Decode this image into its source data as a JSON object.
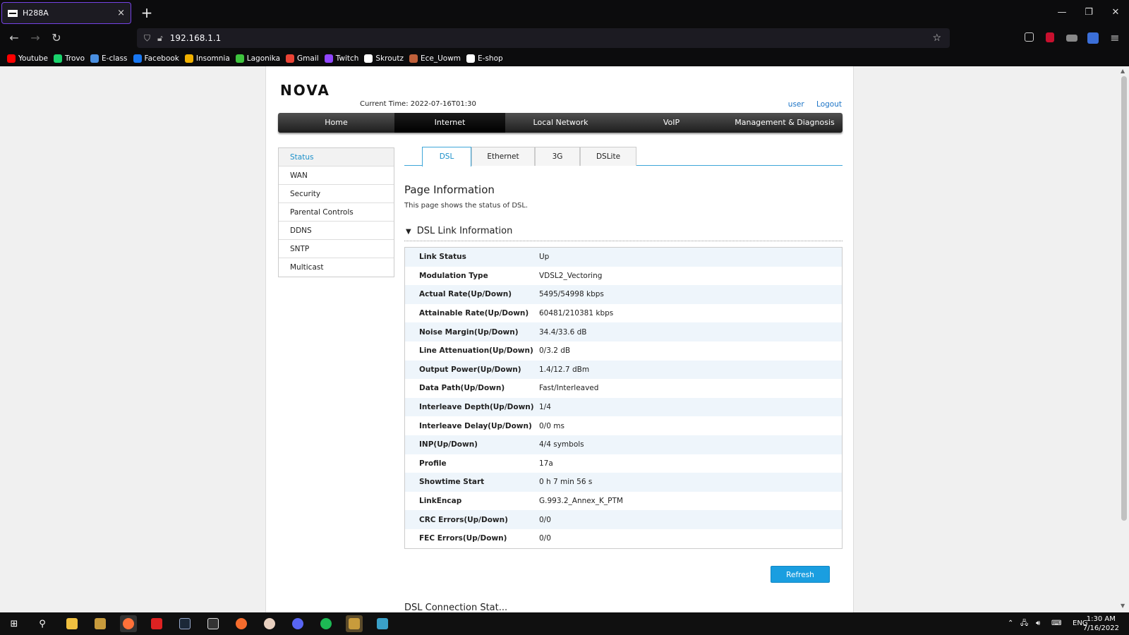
{
  "browser": {
    "tab_title": "H288A",
    "tab_close": "×",
    "new_tab": "+",
    "url": "192.168.1.1",
    "bookmarks": [
      {
        "label": "Youtube",
        "color": "#ff0000"
      },
      {
        "label": "Trovo",
        "color": "#1ad36c"
      },
      {
        "label": "E-class",
        "color": "#4a8fe0"
      },
      {
        "label": "Facebook",
        "color": "#1877f2"
      },
      {
        "label": "Insomnia",
        "color": "#f0b000"
      },
      {
        "label": "Lagonika",
        "color": "#3ec43e"
      },
      {
        "label": "Gmail",
        "color": "#ea4335"
      },
      {
        "label": "Twitch",
        "color": "#9146ff"
      },
      {
        "label": "Skroutz",
        "color": "#ffffff"
      },
      {
        "label": "Ece_Uowm",
        "color": "#c0603a"
      },
      {
        "label": "E-shop",
        "color": "#ffffff"
      }
    ]
  },
  "router": {
    "logo": "NOVA",
    "current_time": "Current Time: 2022-07-16T01:30",
    "user_link": "user",
    "logout_link": "Logout",
    "main_nav": [
      "Home",
      "Internet",
      "Local Network",
      "VoIP",
      "Management & Diagnosis"
    ],
    "active_nav": "Internet",
    "side_menu": [
      "Status",
      "WAN",
      "Security",
      "Parental Controls",
      "DDNS",
      "SNTP",
      "Multicast"
    ],
    "active_side": "Status",
    "sub_tabs": [
      "DSL",
      "Ethernet",
      "3G",
      "DSLite"
    ],
    "active_sub_tab": "DSL",
    "page_info_title": "Page Information",
    "page_info_desc": "This page shows the status of DSL.",
    "section_title": "DSL Link Information",
    "section_toggle": "▼",
    "rows": [
      {
        "k": "Link Status",
        "v": "Up"
      },
      {
        "k": "Modulation Type",
        "v": "VDSL2_Vectoring"
      },
      {
        "k": "Actual Rate(Up/Down)",
        "v": "5495/54998 kbps"
      },
      {
        "k": "Attainable Rate(Up/Down)",
        "v": "60481/210381 kbps"
      },
      {
        "k": "Noise Margin(Up/Down)",
        "v": "34.4/33.6 dB"
      },
      {
        "k": "Line Attenuation(Up/Down)",
        "v": "0/3.2 dB"
      },
      {
        "k": "Output Power(Up/Down)",
        "v": "1.4/12.7 dBm"
      },
      {
        "k": "Data Path(Up/Down)",
        "v": "Fast/Interleaved"
      },
      {
        "k": "Interleave Depth(Up/Down)",
        "v": "1/4"
      },
      {
        "k": "Interleave Delay(Up/Down)",
        "v": "0/0 ms"
      },
      {
        "k": "INP(Up/Down)",
        "v": "4/4 symbols"
      },
      {
        "k": "Profile",
        "v": "17a"
      },
      {
        "k": "Showtime Start",
        "v": "0 h 7 min 56 s"
      },
      {
        "k": "LinkEncap",
        "v": "G.993.2_Annex_K_PTM"
      },
      {
        "k": "CRC Errors(Up/Down)",
        "v": "0/0"
      },
      {
        "k": "FEC Errors(Up/Down)",
        "v": "0/0"
      }
    ],
    "refresh_label": "Refresh",
    "next_section_partial": "DSL Connection Stat..."
  },
  "taskbar": {
    "lang": "ENG",
    "time": "1:30 AM",
    "date": "7/16/2022"
  }
}
